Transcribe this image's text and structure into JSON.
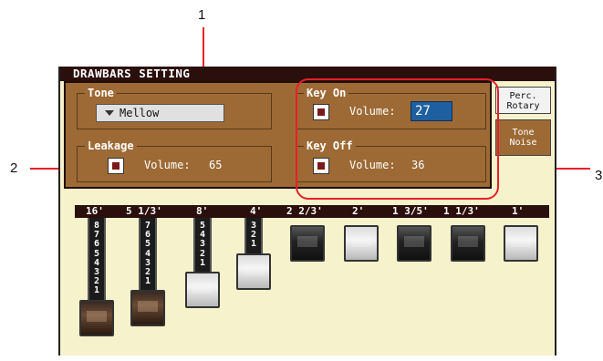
{
  "callouts": [
    "1",
    "2",
    "3"
  ],
  "title": "DRAWBARS SETTING",
  "tone": {
    "label": "Tone",
    "dropdown_value": "Mellow",
    "dropdown_icon": "triangle-down-icon"
  },
  "leakage": {
    "label": "Leakage",
    "checked": true,
    "volume_label": "Volume:",
    "volume_value": "65"
  },
  "key_on": {
    "label": "Key On",
    "checked": true,
    "volume_label": "Volume:",
    "volume_value": "27"
  },
  "key_off": {
    "label": "Key Off",
    "checked": true,
    "volume_label": "Volume:",
    "volume_value": "36"
  },
  "side_tabs": [
    {
      "line1": "Perc.",
      "line2": "Rotary"
    },
    {
      "line1": "Tone",
      "line2": "Noise"
    }
  ],
  "footages": [
    "16'",
    "5 1/3'",
    "8'",
    "4'",
    "2 2/3'",
    "2'",
    "1 3/5'",
    "1 1/3'",
    "1'"
  ],
  "drawbars": [
    {
      "footage": "16'",
      "level": 8,
      "knob": "dark"
    },
    {
      "footage": "5 1/3'",
      "level": 7,
      "knob": "dark"
    },
    {
      "footage": "8'",
      "level": 5,
      "knob": "silver"
    },
    {
      "footage": "4'",
      "level": 3,
      "knob": "silver"
    },
    {
      "footage": "2 2/3'",
      "level": 0,
      "knob": "black"
    },
    {
      "footage": "2'",
      "level": 0,
      "knob": "silver"
    },
    {
      "footage": "1 3/5'",
      "level": 0,
      "knob": "black"
    },
    {
      "footage": "1 1/3'",
      "level": 0,
      "knob": "black"
    },
    {
      "footage": "1'",
      "level": 0,
      "knob": "silver"
    }
  ],
  "colors": {
    "panel": "#9d6a35",
    "title_bar": "#2a0f0c",
    "highlight_outline": "#e8202a",
    "volume_input_bg": "#1e5fa0",
    "screen_bg": "#f6f2cc"
  }
}
